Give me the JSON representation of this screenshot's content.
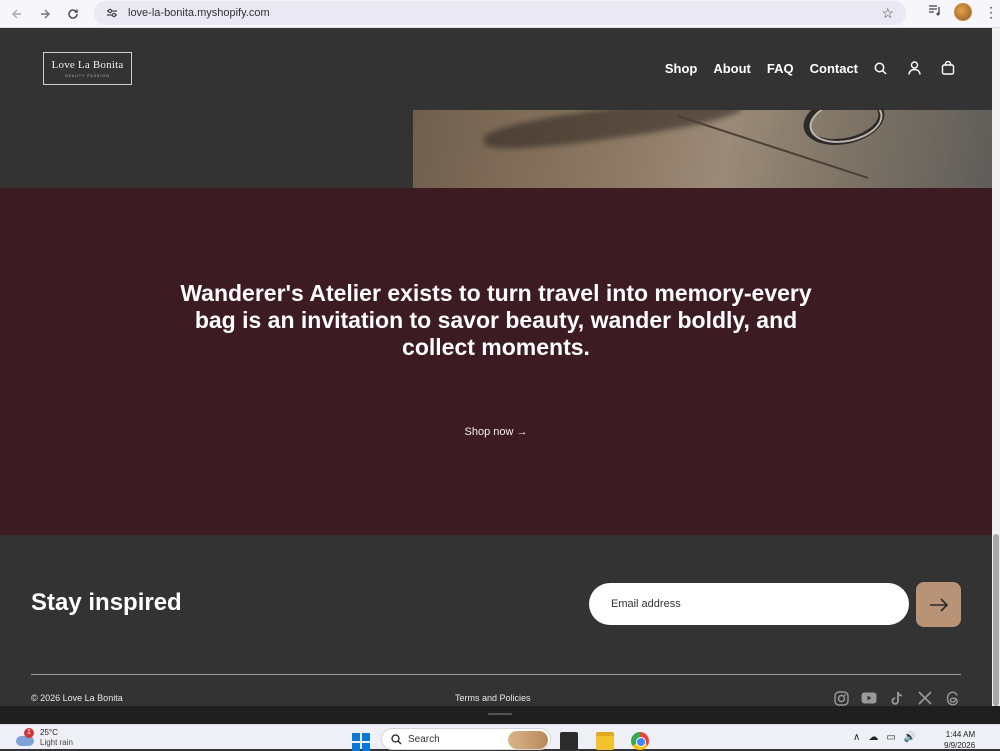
{
  "browser": {
    "url": "love-la-bonita.myshopify.com"
  },
  "header": {
    "logo_main": "Love La Bonita",
    "logo_sub": "BEAUTY PASSION",
    "nav": [
      "Shop",
      "About",
      "FAQ",
      "Contact"
    ]
  },
  "statement": {
    "text": "Wanderer's Atelier exists to turn travel into memory-every bag is an invitation to savor beauty, wander boldly, and collect moments.",
    "cta": "Shop now →"
  },
  "footer": {
    "heading": "Stay inspired",
    "email_placeholder": "Email address",
    "copyright": "© 2026 Love La Bonita",
    "terms": "Terms and Policies",
    "socials": [
      "instagram-icon",
      "youtube-icon",
      "tiktok-icon",
      "x-icon",
      "threads-icon"
    ]
  },
  "taskbar": {
    "weather_temp": "25°C",
    "weather_desc": "Light rain",
    "weather_badge": "1",
    "search_label": "Search",
    "time": "1:44 AM",
    "date": "9/9/2026"
  },
  "colors": {
    "page_bg": "#333333",
    "statement_bg": "#3d1b22",
    "accent_button": "#b99376"
  }
}
